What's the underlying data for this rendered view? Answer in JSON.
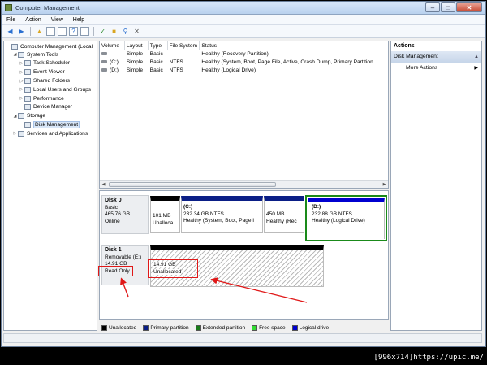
{
  "window": {
    "title": "Computer Management",
    "min": "–",
    "max": "□",
    "close": "✕"
  },
  "menu": [
    "File",
    "Action",
    "View",
    "Help"
  ],
  "tree": [
    {
      "label": "Computer Management (Local",
      "indent": 0,
      "exp": ""
    },
    {
      "label": "System Tools",
      "indent": 1,
      "exp": "◢"
    },
    {
      "label": "Task Scheduler",
      "indent": 2,
      "exp": "▷"
    },
    {
      "label": "Event Viewer",
      "indent": 2,
      "exp": "▷"
    },
    {
      "label": "Shared Folders",
      "indent": 2,
      "exp": "▷"
    },
    {
      "label": "Local Users and Groups",
      "indent": 2,
      "exp": "▷"
    },
    {
      "label": "Performance",
      "indent": 2,
      "exp": "▷"
    },
    {
      "label": "Device Manager",
      "indent": 2,
      "exp": ""
    },
    {
      "label": "Storage",
      "indent": 1,
      "exp": "◢"
    },
    {
      "label": "Disk Management",
      "indent": 2,
      "exp": "",
      "selected": true
    },
    {
      "label": "Services and Applications",
      "indent": 1,
      "exp": "▷"
    }
  ],
  "volumes": {
    "headers": [
      "Volume",
      "Layout",
      "Type",
      "File System",
      "Status"
    ],
    "rows": [
      [
        "",
        "Simple",
        "Basic",
        "",
        "Healthy (Recovery Partition)"
      ],
      [
        "(C:)",
        "Simple",
        "Basic",
        "NTFS",
        "Healthy (System, Boot, Page File, Active, Crash Dump, Primary Partition"
      ],
      [
        "(D:)",
        "Simple",
        "Basic",
        "NTFS",
        "Healthy (Logical Drive)"
      ]
    ]
  },
  "disk0": {
    "name": "Disk 0",
    "type": "Basic",
    "size": "465.76 GB",
    "status": "Online",
    "parts": [
      {
        "title": "",
        "size": "101 MB",
        "status": "Unalloca"
      },
      {
        "title": "(C:)",
        "size": "232.34 GB NTFS",
        "status": "Healthy (System, Boot, Page I"
      },
      {
        "title": "",
        "size": "450 MB",
        "status": "Healthy (Rec"
      },
      {
        "title": "(D:)",
        "size": "232.88 GB NTFS",
        "status": "Healthy (Logical Drive)"
      }
    ]
  },
  "disk1": {
    "name": "Disk 1",
    "type": "Removable (E:)",
    "size": "14.91 GB",
    "status": "Read Only",
    "part": {
      "size": "14.91 GB",
      "status": "Unallocated"
    }
  },
  "legend": [
    {
      "label": "Unallocated",
      "color": "#000000"
    },
    {
      "label": "Primary partition",
      "color": "#0a1e86"
    },
    {
      "label": "Extended partition",
      "color": "#1a7a1a"
    },
    {
      "label": "Free space",
      "color": "#33dd33"
    },
    {
      "label": "Logical drive",
      "color": "#0000d0"
    }
  ],
  "actions": {
    "header": "Actions",
    "section": "Disk Management",
    "item": "More Actions",
    "up": "▲",
    "arrow": "▶"
  },
  "watermark": "[996x714]https://upic.me/",
  "colors": {
    "accent_red": "#e01818",
    "logical_green": "#1a8a1a"
  }
}
